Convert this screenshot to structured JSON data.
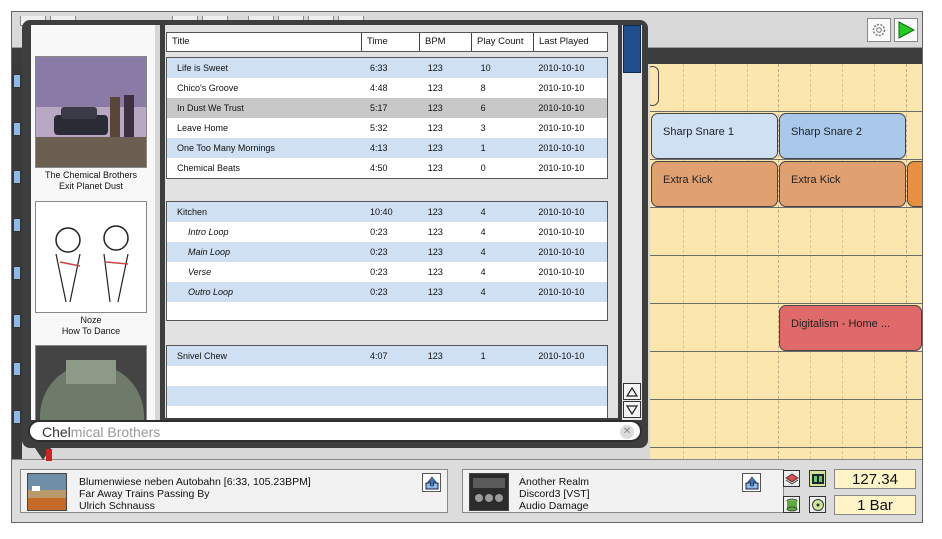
{
  "browser": {
    "columns": [
      "Title",
      "Time",
      "BPM",
      "Play Count",
      "Last Played"
    ],
    "groups": [
      {
        "rows": [
          {
            "title": "Life is Sweet",
            "time": "6:33",
            "bpm": "123",
            "count": "10",
            "last": "2010-10-10"
          },
          {
            "title": "Chico's Groove",
            "time": "4:48",
            "bpm": "123",
            "count": "8",
            "last": "2010-10-10"
          },
          {
            "title": "In Dust We Trust",
            "time": "5:17",
            "bpm": "123",
            "count": "6",
            "last": "2010-10-10"
          },
          {
            "title": "Leave Home",
            "time": "5:32",
            "bpm": "123",
            "count": "3",
            "last": "2010-10-10"
          },
          {
            "title": "One Too Many Mornings",
            "time": "4:13",
            "bpm": "123",
            "count": "1",
            "last": "2010-10-10"
          },
          {
            "title": "Chemical Beats",
            "time": "4:50",
            "bpm": "123",
            "count": "0",
            "last": "2010-10-10"
          }
        ]
      },
      {
        "rows": [
          {
            "title": "Kitchen",
            "time": "10:40",
            "bpm": "123",
            "count": "4",
            "last": "2010-10-10"
          },
          {
            "title": "Intro Loop",
            "time": "0:23",
            "bpm": "123",
            "count": "4",
            "last": "2010-10-10"
          },
          {
            "title": "Main Loop",
            "time": "0:23",
            "bpm": "123",
            "count": "4",
            "last": "2010-10-10"
          },
          {
            "title": "Verse",
            "time": "0:23",
            "bpm": "123",
            "count": "4",
            "last": "2010-10-10"
          },
          {
            "title": "Outro Loop",
            "time": "0:23",
            "bpm": "123",
            "count": "4",
            "last": "2010-10-10"
          }
        ]
      },
      {
        "rows": [
          {
            "title": "Snivel Chew",
            "time": "4:07",
            "bpm": "123",
            "count": "1",
            "last": "2010-10-10"
          }
        ]
      }
    ]
  },
  "albums": [
    {
      "artist": "The Chemical Brothers",
      "title": "Exit Planet Dust"
    },
    {
      "artist": "Noze",
      "title": "How To Dance"
    }
  ],
  "search": {
    "typed": "Chel",
    "completion": "mical Brothers"
  },
  "clips": {
    "snare1": "Sharp Snare 1",
    "snare2": "Sharp Snare 2",
    "kick1": "Extra Kick",
    "kick2": "Extra Kick",
    "digitalism": "Digitalism - Home ..."
  },
  "now_playing": {
    "line1": "Blumenwiese neben Autobahn [6:33, 105.23BPM]",
    "line2": "Far Away Trains Passing By",
    "line3": "Ulrich Schnauss"
  },
  "plugin": {
    "line1": "Another Realm",
    "line2": "Discord3 [VST]",
    "line3": "Audio Damage"
  },
  "tempo": "127.34",
  "quantize": "1 Bar",
  "colors": {
    "selection_blue": "#1f4f8c",
    "row_alt": "#cfe0f3",
    "sequencer_bg": "#fbe6ad",
    "clip_blue_light": "#cfe0f3",
    "clip_blue": "#a9c8ea",
    "clip_orange": "#e0a070",
    "clip_red": "#e06a6a",
    "play_green": "#22cc22"
  }
}
